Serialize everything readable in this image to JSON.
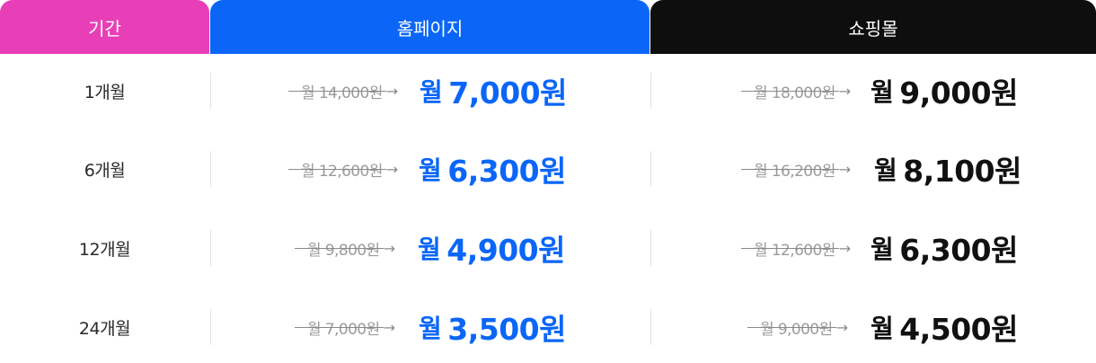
{
  "header": {
    "period": "기간",
    "homepage": "홈페이지",
    "shopping": "쇼핑몰"
  },
  "rows": [
    {
      "period": "1개월",
      "home_old": "월 14,000원",
      "home_prefix": "월",
      "home_new": "7,000원",
      "shop_old": "월 18,000원",
      "shop_prefix": "월",
      "shop_new": "9,000원"
    },
    {
      "period": "6개월",
      "home_old": "월 12,600원",
      "home_prefix": "월",
      "home_new": "6,300원",
      "shop_old": "월 16,200원",
      "shop_prefix": "월",
      "shop_new": "8,100원"
    },
    {
      "period": "12개월",
      "home_old": "월 9,800원",
      "home_prefix": "월",
      "home_new": "4,900원",
      "shop_old": "월 12,600원",
      "shop_prefix": "월",
      "shop_new": "6,300원"
    },
    {
      "period": "24개월",
      "home_old": "월 7,000원",
      "home_prefix": "월",
      "home_new": "3,500원",
      "shop_old": "월 9,000원",
      "shop_prefix": "월",
      "shop_new": "4,500원"
    }
  ],
  "arrow_icon": "arrow-right-icon",
  "colors": {
    "period_header": "#e83fb8",
    "homepage_header": "#0b66f7",
    "shopping_header": "#0e0e0e",
    "homepage_price": "#0b66f7",
    "shopping_price": "#111111",
    "old_price": "#9b9b9b"
  }
}
